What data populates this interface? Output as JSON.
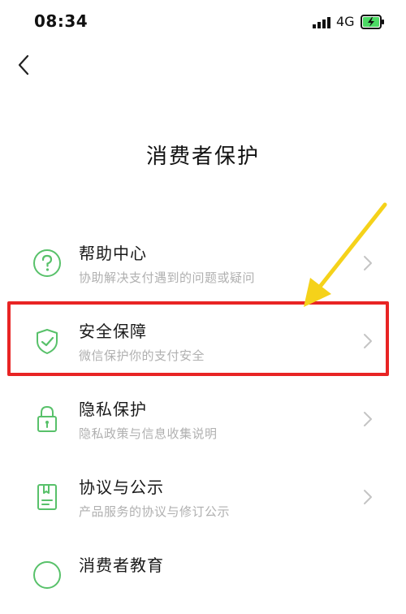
{
  "status_bar": {
    "time": "08:34",
    "network": "4G"
  },
  "header": {
    "title": "消费者保护"
  },
  "menu": {
    "items": [
      {
        "title": "帮助中心",
        "subtitle": "协助解决支付遇到的问题或疑问",
        "icon": "question-circle-icon"
      },
      {
        "title": "安全保障",
        "subtitle": "微信保护你的支付安全",
        "icon": "shield-check-icon"
      },
      {
        "title": "隐私保护",
        "subtitle": "隐私政策与信息收集说明",
        "icon": "lock-icon"
      },
      {
        "title": "协议与公示",
        "subtitle": "产品服务的协议与修订公示",
        "icon": "document-icon"
      },
      {
        "title": "消费者教育",
        "subtitle": "",
        "icon": "education-icon"
      }
    ]
  },
  "colors": {
    "accent": "#58c16a",
    "highlight": "#e82424",
    "arrow": "#f5d21a"
  }
}
